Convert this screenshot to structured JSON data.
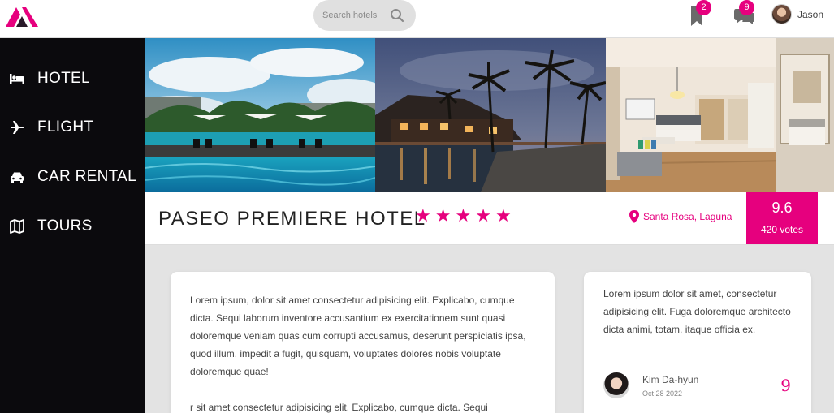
{
  "brand": {
    "logo_icon": "brand-logo-icon",
    "accent_color": "#e6007e"
  },
  "header": {
    "search_placeholder": "Search hotels",
    "bookmarks_count": "2",
    "messages_count": "9",
    "user_name": "Jason"
  },
  "sidebar": {
    "background": "#0b0a0d",
    "items": [
      {
        "label": "HOTEL",
        "icon": "bed-icon"
      },
      {
        "label": "FLIGHT",
        "icon": "plane-icon"
      },
      {
        "label": "CAR RENTAL",
        "icon": "car-icon"
      },
      {
        "label": "TOURS",
        "icon": "map-icon"
      }
    ]
  },
  "hotel": {
    "name": "PASEO PREMIERE HOTEL",
    "stars": 5,
    "location": "Santa Rosa, Laguna",
    "score": "9.6",
    "votes": "420 votes"
  },
  "description": {
    "paragraph1": "Lorem ipsum, dolor sit amet consectetur adipisicing elit. Explicabo, cumque dicta. Sequi laborum inventore accusantium ex exercitationem sunt quasi doloremque veniam quas cum corrupti accusamus, deserunt perspiciatis ipsa, quod illum. impedit a fugit, quisquam, voluptates dolores nobis voluptate doloremque quae!",
    "paragraph2": "r sit amet consectetur adipisicing elit. Explicabo, cumque dicta. Sequi"
  },
  "review": {
    "text": "Lorem ipsum dolor sit amet, consectetur adipisicing elit. Fuga doloremque architecto dicta animi, totam, itaque officia ex.",
    "reviewer_name": "Kim Da-hyun",
    "date": "Oct 28 2022",
    "score": "9"
  }
}
